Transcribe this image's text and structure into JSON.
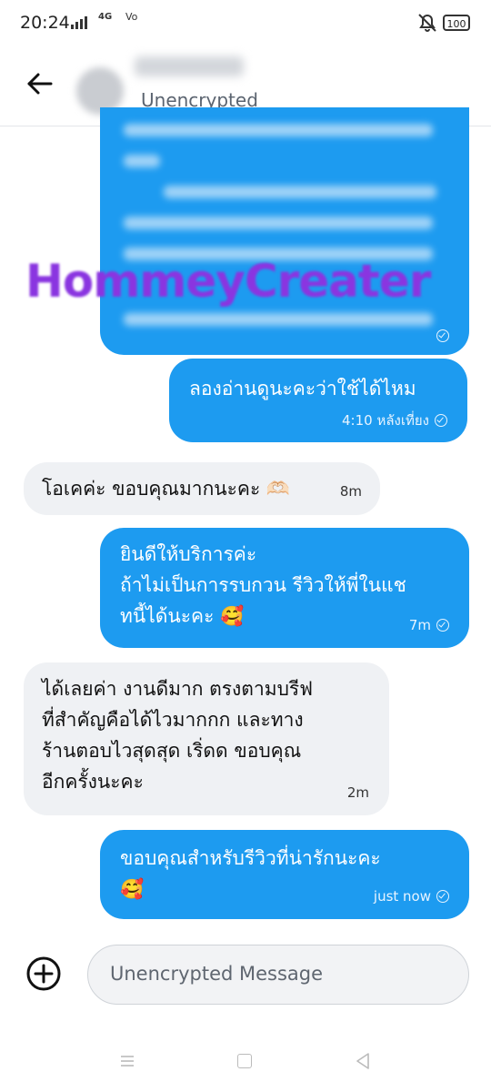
{
  "status_bar": {
    "time": "20:24",
    "network": "4G",
    "vo_label": "Vo",
    "battery": "100"
  },
  "header": {
    "subtitle": "Unencrypted"
  },
  "watermark": "HommeyCreater",
  "messages": [
    {
      "direction": "out",
      "text": "",
      "time": "",
      "read": true
    },
    {
      "direction": "out",
      "text": "ลองอ่านดูนะคะว่าใช้ได้ไหม",
      "time": "4:10 หลังเที่ยง",
      "read": true
    },
    {
      "direction": "in",
      "text": "โอเคค่ะ ขอบคุณมากนะคะ 🫶🏻",
      "time": "8m"
    },
    {
      "direction": "out",
      "text": "ยินดีให้บริการค่ะ\nถ้าไม่เป็นการรบกวน รีวิวให้พี่ในแช\nทนี้ได้นะคะ 🥰",
      "time": "7m",
      "read": true
    },
    {
      "direction": "in",
      "text": "ได้เลยค่า งานดีมาก ตรงตามบรีฟ\nที่สำคัญคือได้ไวมากกก และทาง\nร้านตอบไวสุดสุด เริ่ดด ขอบคุณ\nอีกครั้งนะคะ",
      "time": "2m"
    },
    {
      "direction": "out",
      "text": "ขอบคุณสำหรับรีวิวที่น่ารักนะคะ\n🥰",
      "time": "just now",
      "read": true
    }
  ],
  "composer": {
    "placeholder": "Unencrypted Message"
  },
  "colors": {
    "outgoing_bubble": "#1d9bf0",
    "incoming_bubble": "#eff1f4",
    "watermark": "#8a35e0"
  }
}
